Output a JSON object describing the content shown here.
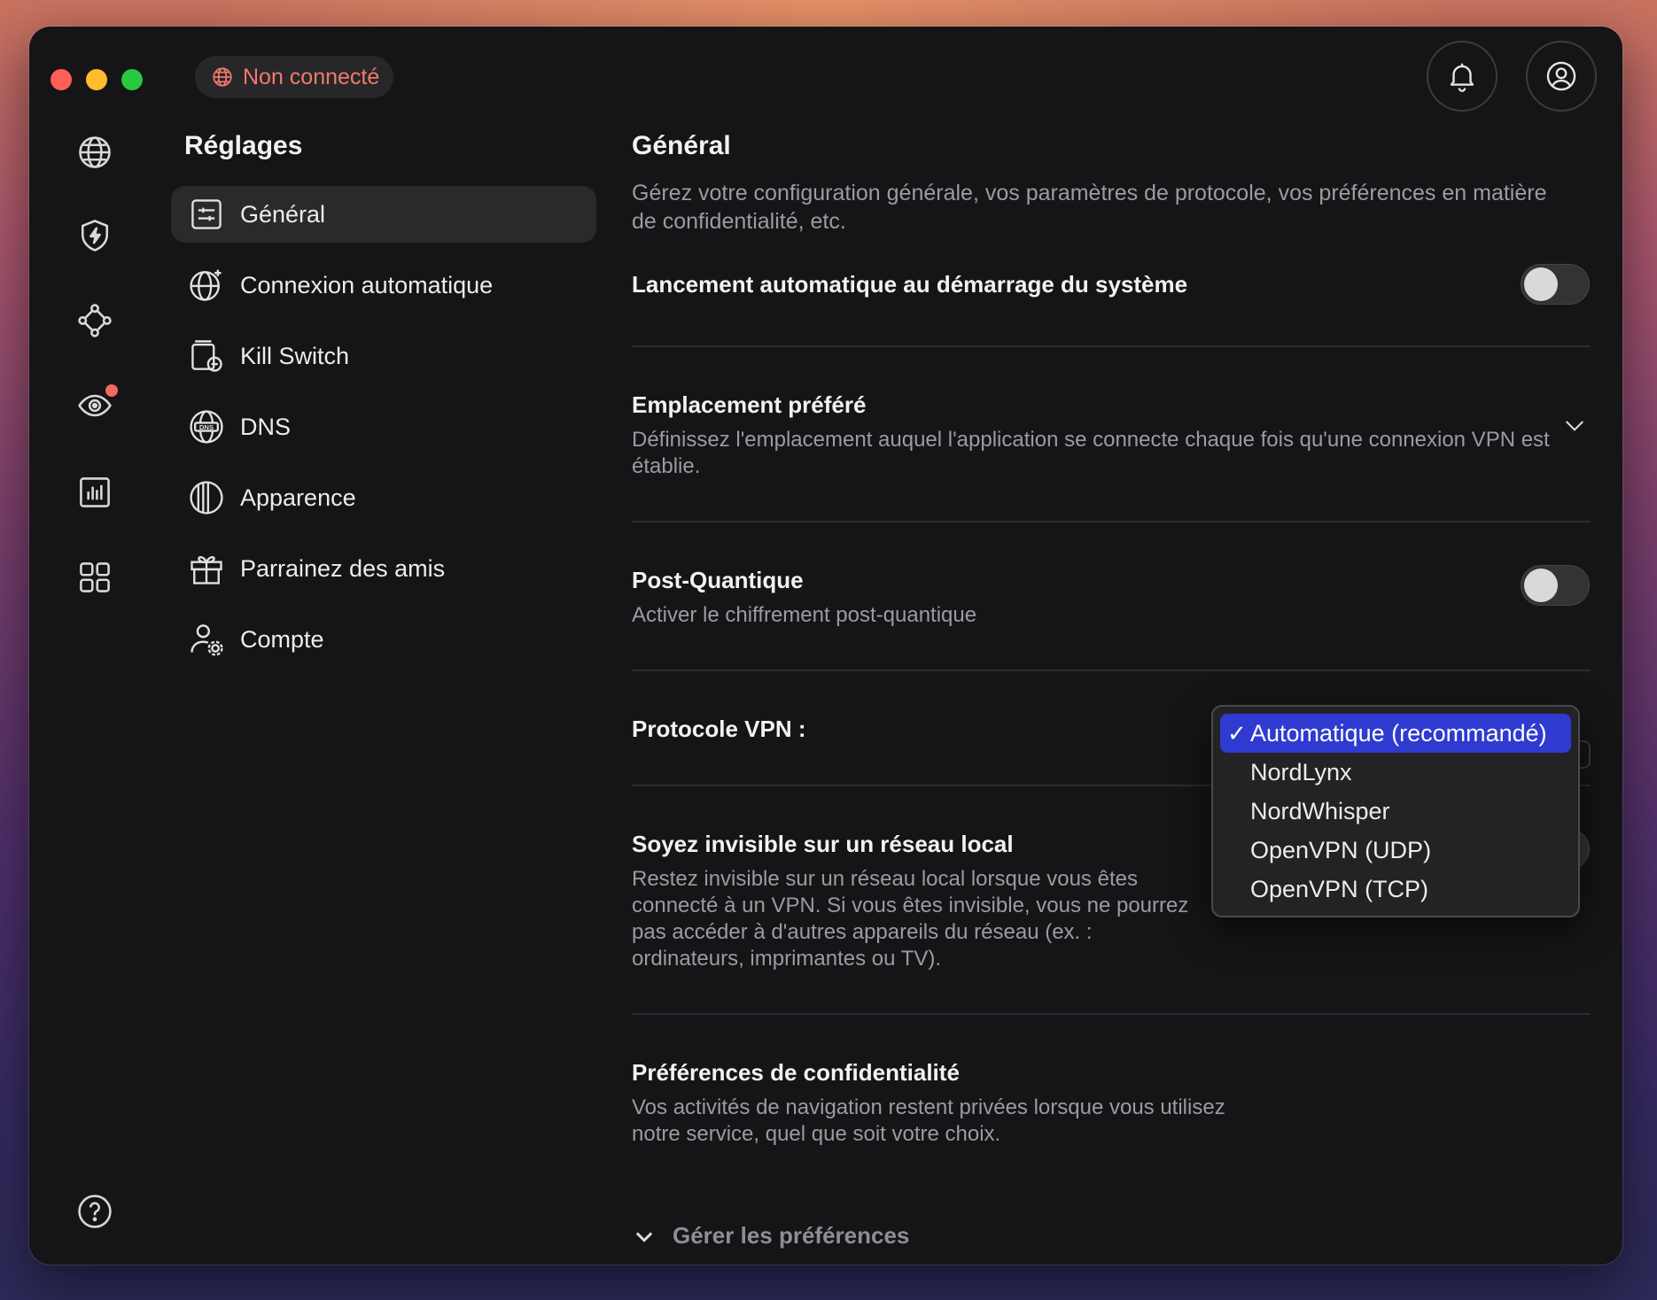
{
  "status": {
    "label": "Non connecté",
    "color": "#f07a6a"
  },
  "header": {
    "bell_icon": "bell-icon",
    "account_icon": "account-icon"
  },
  "rail": [
    "globe-icon",
    "shield-bolt-icon",
    "meshnet-icon",
    "threat-radar-icon",
    "stats-icon",
    "apps-grid-icon",
    "help-icon"
  ],
  "nav": {
    "title": "Réglages",
    "items": [
      {
        "label": "Général",
        "icon": "sliders-icon",
        "active": true
      },
      {
        "label": "Connexion automatique",
        "icon": "globe-sparkle-icon"
      },
      {
        "label": "Kill Switch",
        "icon": "kill-switch-icon"
      },
      {
        "label": "DNS",
        "icon": "dns-icon"
      },
      {
        "label": "Apparence",
        "icon": "appearance-icon"
      },
      {
        "label": "Parrainez des amis",
        "icon": "gift-icon"
      },
      {
        "label": "Compte",
        "icon": "account-settings-icon"
      }
    ]
  },
  "content": {
    "title": "Général",
    "description": "Gérez votre configuration générale, vos paramètres de protocole, vos préférences en matière de confidentialité, etc.",
    "autostart": {
      "title": "Lancement automatique au démarrage du système",
      "enabled": false
    },
    "location": {
      "title": "Emplacement préféré",
      "description": "Définissez l'emplacement auquel l'application se connecte chaque fois qu'une connexion VPN est établie."
    },
    "pq": {
      "title": "Post-Quantique",
      "description": "Activer le chiffrement post-quantique",
      "enabled": false
    },
    "protocol": {
      "title": "Protocole VPN :",
      "options": [
        "Automatique (recommandé)",
        "NordLynx",
        "NordWhisper",
        "OpenVPN (UDP)",
        "OpenVPN (TCP)"
      ],
      "selected": "Automatique (recommandé)",
      "check": "✓"
    },
    "invisible": {
      "title": "Soyez invisible sur un réseau local",
      "description_lines": [
        "Restez invisible sur un réseau local lorsque vous êtes",
        "connecté à un VPN. Si vous êtes invisible, vous ne pourrez",
        "pas accéder à d'autres appareils du réseau (ex. :",
        "ordinateurs, imprimantes ou TV)."
      ]
    },
    "privacy": {
      "title": "Préférences de confidentialité",
      "description_lines": [
        "Vos activités de navigation restent privées lorsque vous utilisez",
        "notre service, quel que soit votre choix."
      ],
      "manage": "Gérer les préférences"
    }
  }
}
